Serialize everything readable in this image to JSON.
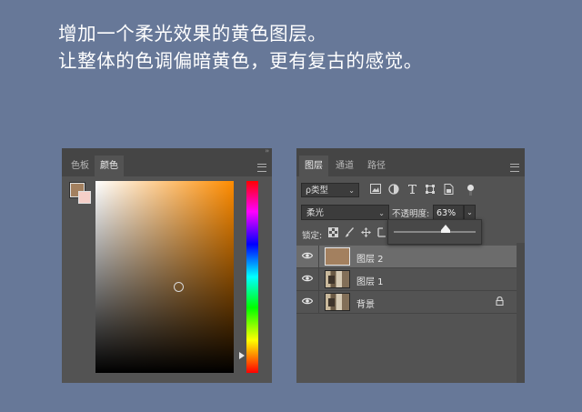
{
  "caption": {
    "line1": "增加一个柔光效果的黄色图层。",
    "line2": "让整体的色调偏暗黄色，更有复古的感觉。"
  },
  "color_panel": {
    "tabs": [
      "色板",
      "颜色"
    ],
    "active_tab": "颜色",
    "collapse_glyph": "››",
    "foreground_color": "#a3805f",
    "background_color": "#f5cfc8",
    "gradient_hue_color": "#ff8c00"
  },
  "layers_panel": {
    "tabs": [
      "图层",
      "通道",
      "路径"
    ],
    "active_tab": "图层",
    "filter": {
      "selected": "ρ类型",
      "dropdown_glyph": "⌄",
      "icons": [
        "image-filter-icon",
        "adjustment-filter-icon",
        "type-filter-icon",
        "shape-filter-icon",
        "smart-object-filter-icon"
      ]
    },
    "blend_mode": "柔光",
    "blend_dropdown_glyph": "⌄",
    "opacity_label": "不透明度:",
    "opacity_value": "63%",
    "opacity_fraction": 0.63,
    "lock_label": "锁定:",
    "layers": [
      {
        "name": "图层 2",
        "selected": true,
        "thumb": "fill",
        "locked": false
      },
      {
        "name": "图层 1",
        "selected": false,
        "thumb": "photo",
        "locked": false
      },
      {
        "name": "背景",
        "selected": false,
        "thumb": "photo",
        "locked": true
      }
    ]
  }
}
